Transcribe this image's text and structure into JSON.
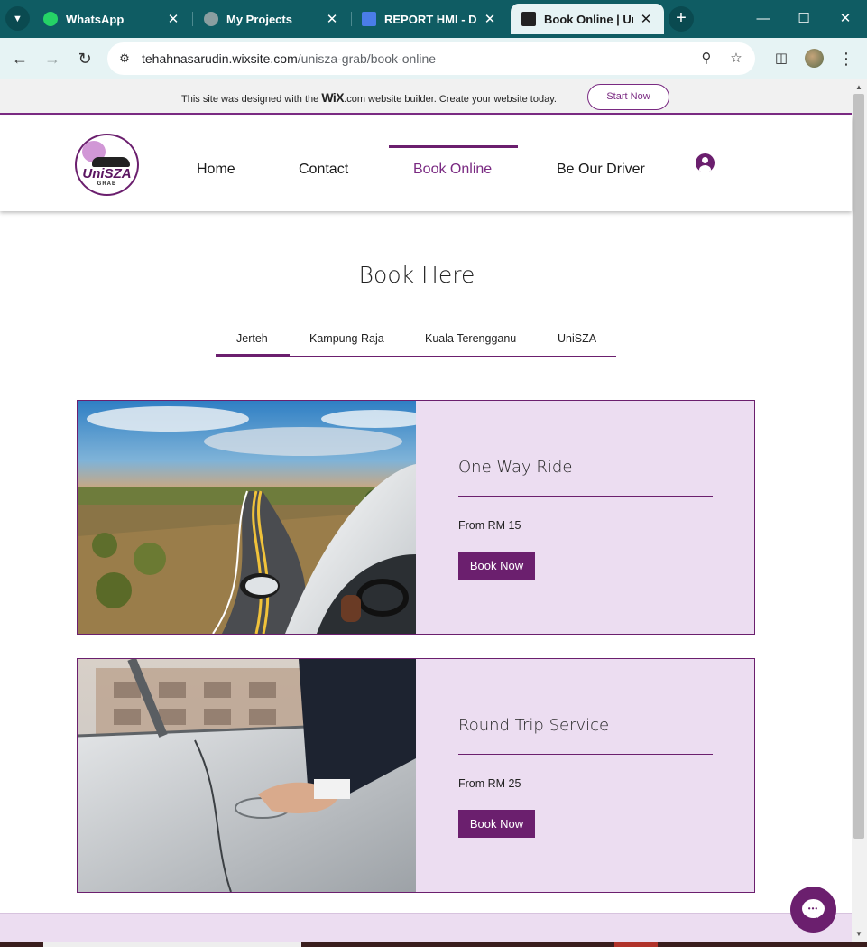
{
  "browser": {
    "tabs": [
      {
        "title": "WhatsApp",
        "icon": "whatsapp-icon"
      },
      {
        "title": "My Projects",
        "icon": "globe-icon"
      },
      {
        "title": "REPORT HMI - Dok",
        "icon": "docs-icon"
      },
      {
        "title": "Book Online | Unis",
        "icon": "wix-icon"
      }
    ],
    "active_tab_index": 3,
    "url_host": "tehahnasarudin.wixsite.com",
    "url_path": "/unisza-grab/book-online"
  },
  "wix_banner": {
    "text_before": "This site was designed with the ",
    "brand": "WiX",
    "text_after": ".com website builder. Create your website today.",
    "cta": "Start Now"
  },
  "site": {
    "logo": {
      "name": "UniSZA",
      "sub": "GRAB"
    },
    "nav": [
      "Home",
      "Contact",
      "Book Online",
      "Be Our Driver"
    ],
    "active_nav": "Book Online"
  },
  "page": {
    "title": "Book Here",
    "location_tabs": [
      "Jerteh",
      "Kampung Raja",
      "Kuala Terengganu",
      "UniSZA"
    ],
    "active_location": "Jerteh",
    "services": [
      {
        "name": "One Way Ride",
        "price": "From RM 15",
        "button": "Book Now"
      },
      {
        "name": "Round Trip Service",
        "price": "From RM 25",
        "button": "Book Now"
      }
    ]
  },
  "colors": {
    "brand_purple": "#6b1f6e",
    "card_bg": "#ecddf1",
    "chrome_teal": "#0f5c63"
  }
}
